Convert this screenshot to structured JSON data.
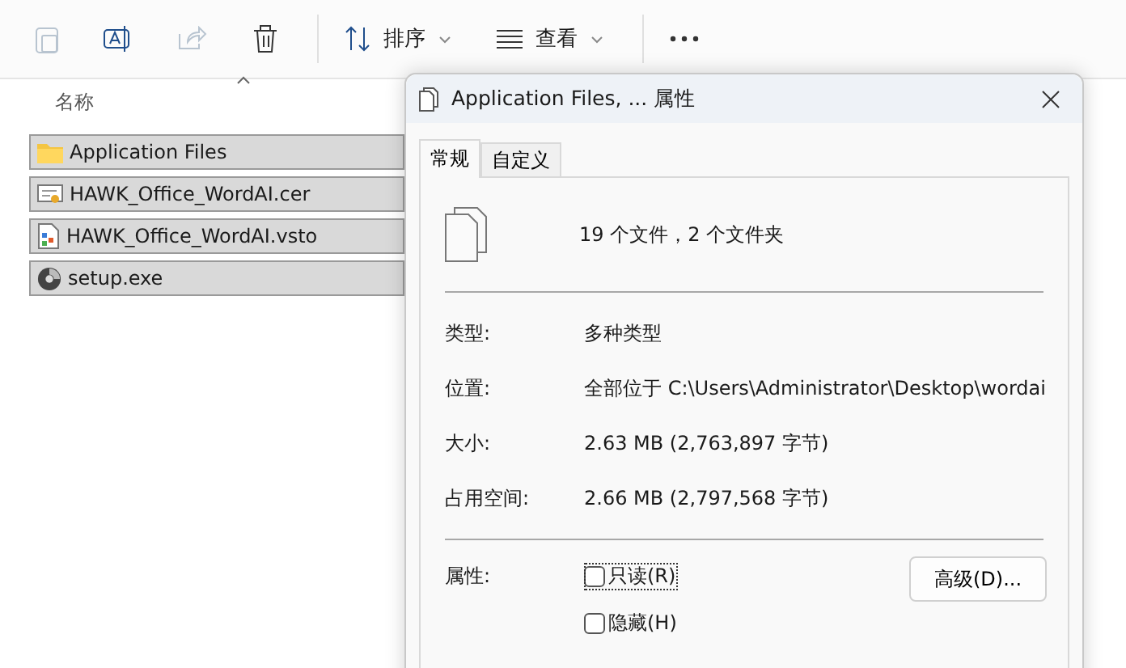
{
  "toolbar": {
    "sort_label": "排序",
    "view_label": "查看"
  },
  "file_list": {
    "column_header": "名称",
    "files": [
      {
        "name": "Application Files",
        "kind": "folder",
        "selected": true
      },
      {
        "name": "HAWK_Office_WordAI.cer",
        "kind": "certificate",
        "selected": true
      },
      {
        "name": "HAWK_Office_WordAI.vsto",
        "kind": "manifest",
        "selected": true
      },
      {
        "name": "setup.exe",
        "kind": "installer",
        "selected": true
      }
    ]
  },
  "dialog": {
    "title": "Application Files, ... 属性",
    "tabs": [
      {
        "label": "常规",
        "selected": true
      },
      {
        "label": "自定义",
        "selected": false
      }
    ],
    "summary": "19 个文件，2 个文件夹",
    "details": [
      {
        "label": "类型:",
        "value": "多种类型"
      },
      {
        "label": "位置:",
        "value": "全部位于 C:\\Users\\Administrator\\Desktop\\wordai"
      },
      {
        "label": "大小:",
        "value": "2.63 MB (2,763,897 字节)"
      },
      {
        "label": "占用空间:",
        "value": "2.66 MB (2,797,568 字节)"
      }
    ],
    "attributes_label": "属性:",
    "attributes": [
      {
        "label": "只读(R)",
        "checked": false,
        "focused": true
      },
      {
        "label": "隐藏(H)",
        "checked": false,
        "focused": false
      }
    ],
    "advanced_button": "高级(D)..."
  }
}
